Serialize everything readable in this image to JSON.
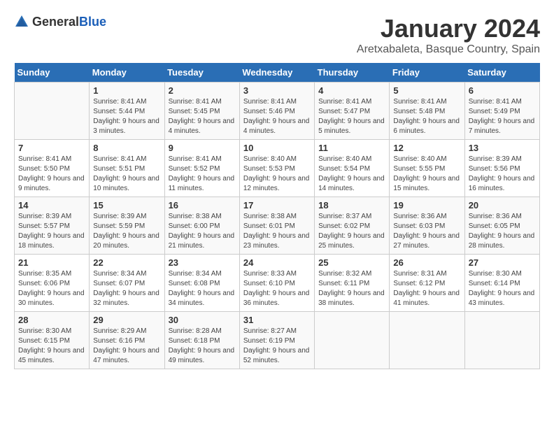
{
  "header": {
    "logo_general": "General",
    "logo_blue": "Blue",
    "title": "January 2024",
    "subtitle": "Aretxabaleta, Basque Country, Spain"
  },
  "calendar": {
    "days_of_week": [
      "Sunday",
      "Monday",
      "Tuesday",
      "Wednesday",
      "Thursday",
      "Friday",
      "Saturday"
    ],
    "weeks": [
      [
        {
          "day": "",
          "info": ""
        },
        {
          "day": "1",
          "info": "Sunrise: 8:41 AM\nSunset: 5:44 PM\nDaylight: 9 hours\nand 3 minutes."
        },
        {
          "day": "2",
          "info": "Sunrise: 8:41 AM\nSunset: 5:45 PM\nDaylight: 9 hours\nand 4 minutes."
        },
        {
          "day": "3",
          "info": "Sunrise: 8:41 AM\nSunset: 5:46 PM\nDaylight: 9 hours\nand 4 minutes."
        },
        {
          "day": "4",
          "info": "Sunrise: 8:41 AM\nSunset: 5:47 PM\nDaylight: 9 hours\nand 5 minutes."
        },
        {
          "day": "5",
          "info": "Sunrise: 8:41 AM\nSunset: 5:48 PM\nDaylight: 9 hours\nand 6 minutes."
        },
        {
          "day": "6",
          "info": "Sunrise: 8:41 AM\nSunset: 5:49 PM\nDaylight: 9 hours\nand 7 minutes."
        }
      ],
      [
        {
          "day": "7",
          "info": "Sunrise: 8:41 AM\nSunset: 5:50 PM\nDaylight: 9 hours\nand 9 minutes."
        },
        {
          "day": "8",
          "info": "Sunrise: 8:41 AM\nSunset: 5:51 PM\nDaylight: 9 hours\nand 10 minutes."
        },
        {
          "day": "9",
          "info": "Sunrise: 8:41 AM\nSunset: 5:52 PM\nDaylight: 9 hours\nand 11 minutes."
        },
        {
          "day": "10",
          "info": "Sunrise: 8:40 AM\nSunset: 5:53 PM\nDaylight: 9 hours\nand 12 minutes."
        },
        {
          "day": "11",
          "info": "Sunrise: 8:40 AM\nSunset: 5:54 PM\nDaylight: 9 hours\nand 14 minutes."
        },
        {
          "day": "12",
          "info": "Sunrise: 8:40 AM\nSunset: 5:55 PM\nDaylight: 9 hours\nand 15 minutes."
        },
        {
          "day": "13",
          "info": "Sunrise: 8:39 AM\nSunset: 5:56 PM\nDaylight: 9 hours\nand 16 minutes."
        }
      ],
      [
        {
          "day": "14",
          "info": "Sunrise: 8:39 AM\nSunset: 5:57 PM\nDaylight: 9 hours\nand 18 minutes."
        },
        {
          "day": "15",
          "info": "Sunrise: 8:39 AM\nSunset: 5:59 PM\nDaylight: 9 hours\nand 20 minutes."
        },
        {
          "day": "16",
          "info": "Sunrise: 8:38 AM\nSunset: 6:00 PM\nDaylight: 9 hours\nand 21 minutes."
        },
        {
          "day": "17",
          "info": "Sunrise: 8:38 AM\nSunset: 6:01 PM\nDaylight: 9 hours\nand 23 minutes."
        },
        {
          "day": "18",
          "info": "Sunrise: 8:37 AM\nSunset: 6:02 PM\nDaylight: 9 hours\nand 25 minutes."
        },
        {
          "day": "19",
          "info": "Sunrise: 8:36 AM\nSunset: 6:03 PM\nDaylight: 9 hours\nand 27 minutes."
        },
        {
          "day": "20",
          "info": "Sunrise: 8:36 AM\nSunset: 6:05 PM\nDaylight: 9 hours\nand 28 minutes."
        }
      ],
      [
        {
          "day": "21",
          "info": "Sunrise: 8:35 AM\nSunset: 6:06 PM\nDaylight: 9 hours\nand 30 minutes."
        },
        {
          "day": "22",
          "info": "Sunrise: 8:34 AM\nSunset: 6:07 PM\nDaylight: 9 hours\nand 32 minutes."
        },
        {
          "day": "23",
          "info": "Sunrise: 8:34 AM\nSunset: 6:08 PM\nDaylight: 9 hours\nand 34 minutes."
        },
        {
          "day": "24",
          "info": "Sunrise: 8:33 AM\nSunset: 6:10 PM\nDaylight: 9 hours\nand 36 minutes."
        },
        {
          "day": "25",
          "info": "Sunrise: 8:32 AM\nSunset: 6:11 PM\nDaylight: 9 hours\nand 38 minutes."
        },
        {
          "day": "26",
          "info": "Sunrise: 8:31 AM\nSunset: 6:12 PM\nDaylight: 9 hours\nand 41 minutes."
        },
        {
          "day": "27",
          "info": "Sunrise: 8:30 AM\nSunset: 6:14 PM\nDaylight: 9 hours\nand 43 minutes."
        }
      ],
      [
        {
          "day": "28",
          "info": "Sunrise: 8:30 AM\nSunset: 6:15 PM\nDaylight: 9 hours\nand 45 minutes."
        },
        {
          "day": "29",
          "info": "Sunrise: 8:29 AM\nSunset: 6:16 PM\nDaylight: 9 hours\nand 47 minutes."
        },
        {
          "day": "30",
          "info": "Sunrise: 8:28 AM\nSunset: 6:18 PM\nDaylight: 9 hours\nand 49 minutes."
        },
        {
          "day": "31",
          "info": "Sunrise: 8:27 AM\nSunset: 6:19 PM\nDaylight: 9 hours\nand 52 minutes."
        },
        {
          "day": "",
          "info": ""
        },
        {
          "day": "",
          "info": ""
        },
        {
          "day": "",
          "info": ""
        }
      ]
    ]
  }
}
